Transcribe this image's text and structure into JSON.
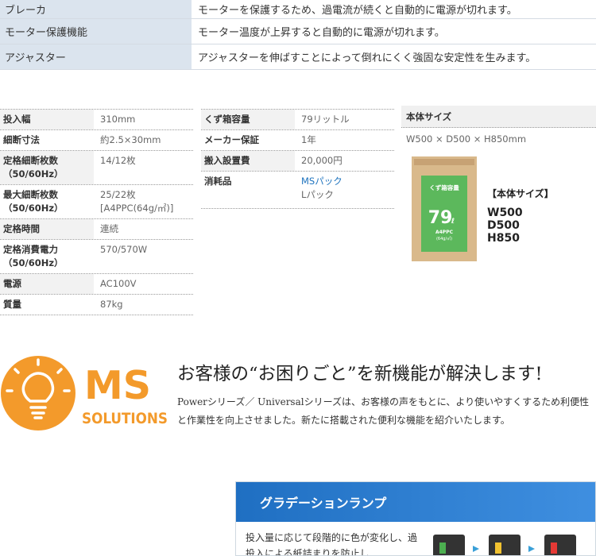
{
  "features": [
    {
      "name": "ブレーカ",
      "desc": "モーターを保護するため、過電流が続くと自動的に電源が切れます。"
    },
    {
      "name": "モーター保護機能",
      "desc": "モーター温度が上昇すると自動的に電源が切れます。"
    },
    {
      "name": "アジャスター",
      "desc": "アジャスターを伸ばすことによって倒れにくく強固な安定性を生みます。"
    }
  ],
  "specs_left": [
    {
      "key": "投入幅",
      "val": "310mm"
    },
    {
      "key": "細断寸法",
      "val": "約2.5×30mm"
    },
    {
      "key": "定格細断枚数\n（50/60Hz）",
      "val": "14/12枚"
    },
    {
      "key": "最大細断枚数\n（50/60Hz）",
      "val": "25/22枚\n[A4PPC(64g/㎡)]"
    },
    {
      "key": "定格時間",
      "val": "連続"
    },
    {
      "key": "定格消費電力\n（50/60Hz）",
      "val": "570/570W"
    },
    {
      "key": "電源",
      "val": "AC100V"
    },
    {
      "key": "質量",
      "val": "87kg"
    }
  ],
  "specs_mid": [
    {
      "key": "くず箱容量",
      "val": "79リットル"
    },
    {
      "key": "メーカー保証",
      "val": "1年"
    },
    {
      "key": "搬入設置費",
      "val": "20,000円"
    },
    {
      "key": "消耗品",
      "val_link": "MSパック",
      "val": "Lパック"
    }
  ],
  "size": {
    "header": "本体サイズ",
    "value": "W500 × D500 × H850mm",
    "caption": "【本体サイズ】",
    "dims": [
      "W500",
      "D500",
      "H850"
    ],
    "box_label": "くず箱容量",
    "box_capacity": "79",
    "box_unit": "ℓ",
    "box_paper": "A4PPC",
    "box_weight": "(64g/㎡)"
  },
  "ms": {
    "logo_ms": "MS",
    "logo_solutions": "SOLUTIONS",
    "headline": "お客様の“お困りごと”を新機能が解決します!",
    "desc": "Powerシリーズ／ Universalシリーズは、お客様の声をもとに、より使いやすくするため利便性と作業性を向上させました。新たに搭載された便利な機能を紹介いたします。"
  },
  "lamp": {
    "title": "グラデーションランプ",
    "text": "投入量に応じて段階的に色が変化し、過投入による紙詰まりを防止し"
  },
  "colors": {
    "feature_bg": "#dbe4ee",
    "orange": "#f39a2b",
    "green": "#4caf50",
    "blue": "#1f6fc2",
    "link": "#1e73be"
  }
}
